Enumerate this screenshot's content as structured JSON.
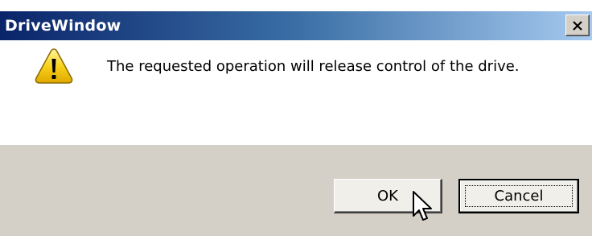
{
  "window": {
    "title": "DriveWindow",
    "close_glyph": "×"
  },
  "message": {
    "icon": "warning-icon",
    "text": "The requested operation will release control of the drive."
  },
  "buttons": {
    "ok_label": "OK",
    "cancel_label": "Cancel"
  },
  "colors": {
    "titlebar_start": "#0a246a",
    "titlebar_end": "#a6caf0",
    "button_bar": "#d4d0c8",
    "warning_yellow": "#f4c400"
  }
}
